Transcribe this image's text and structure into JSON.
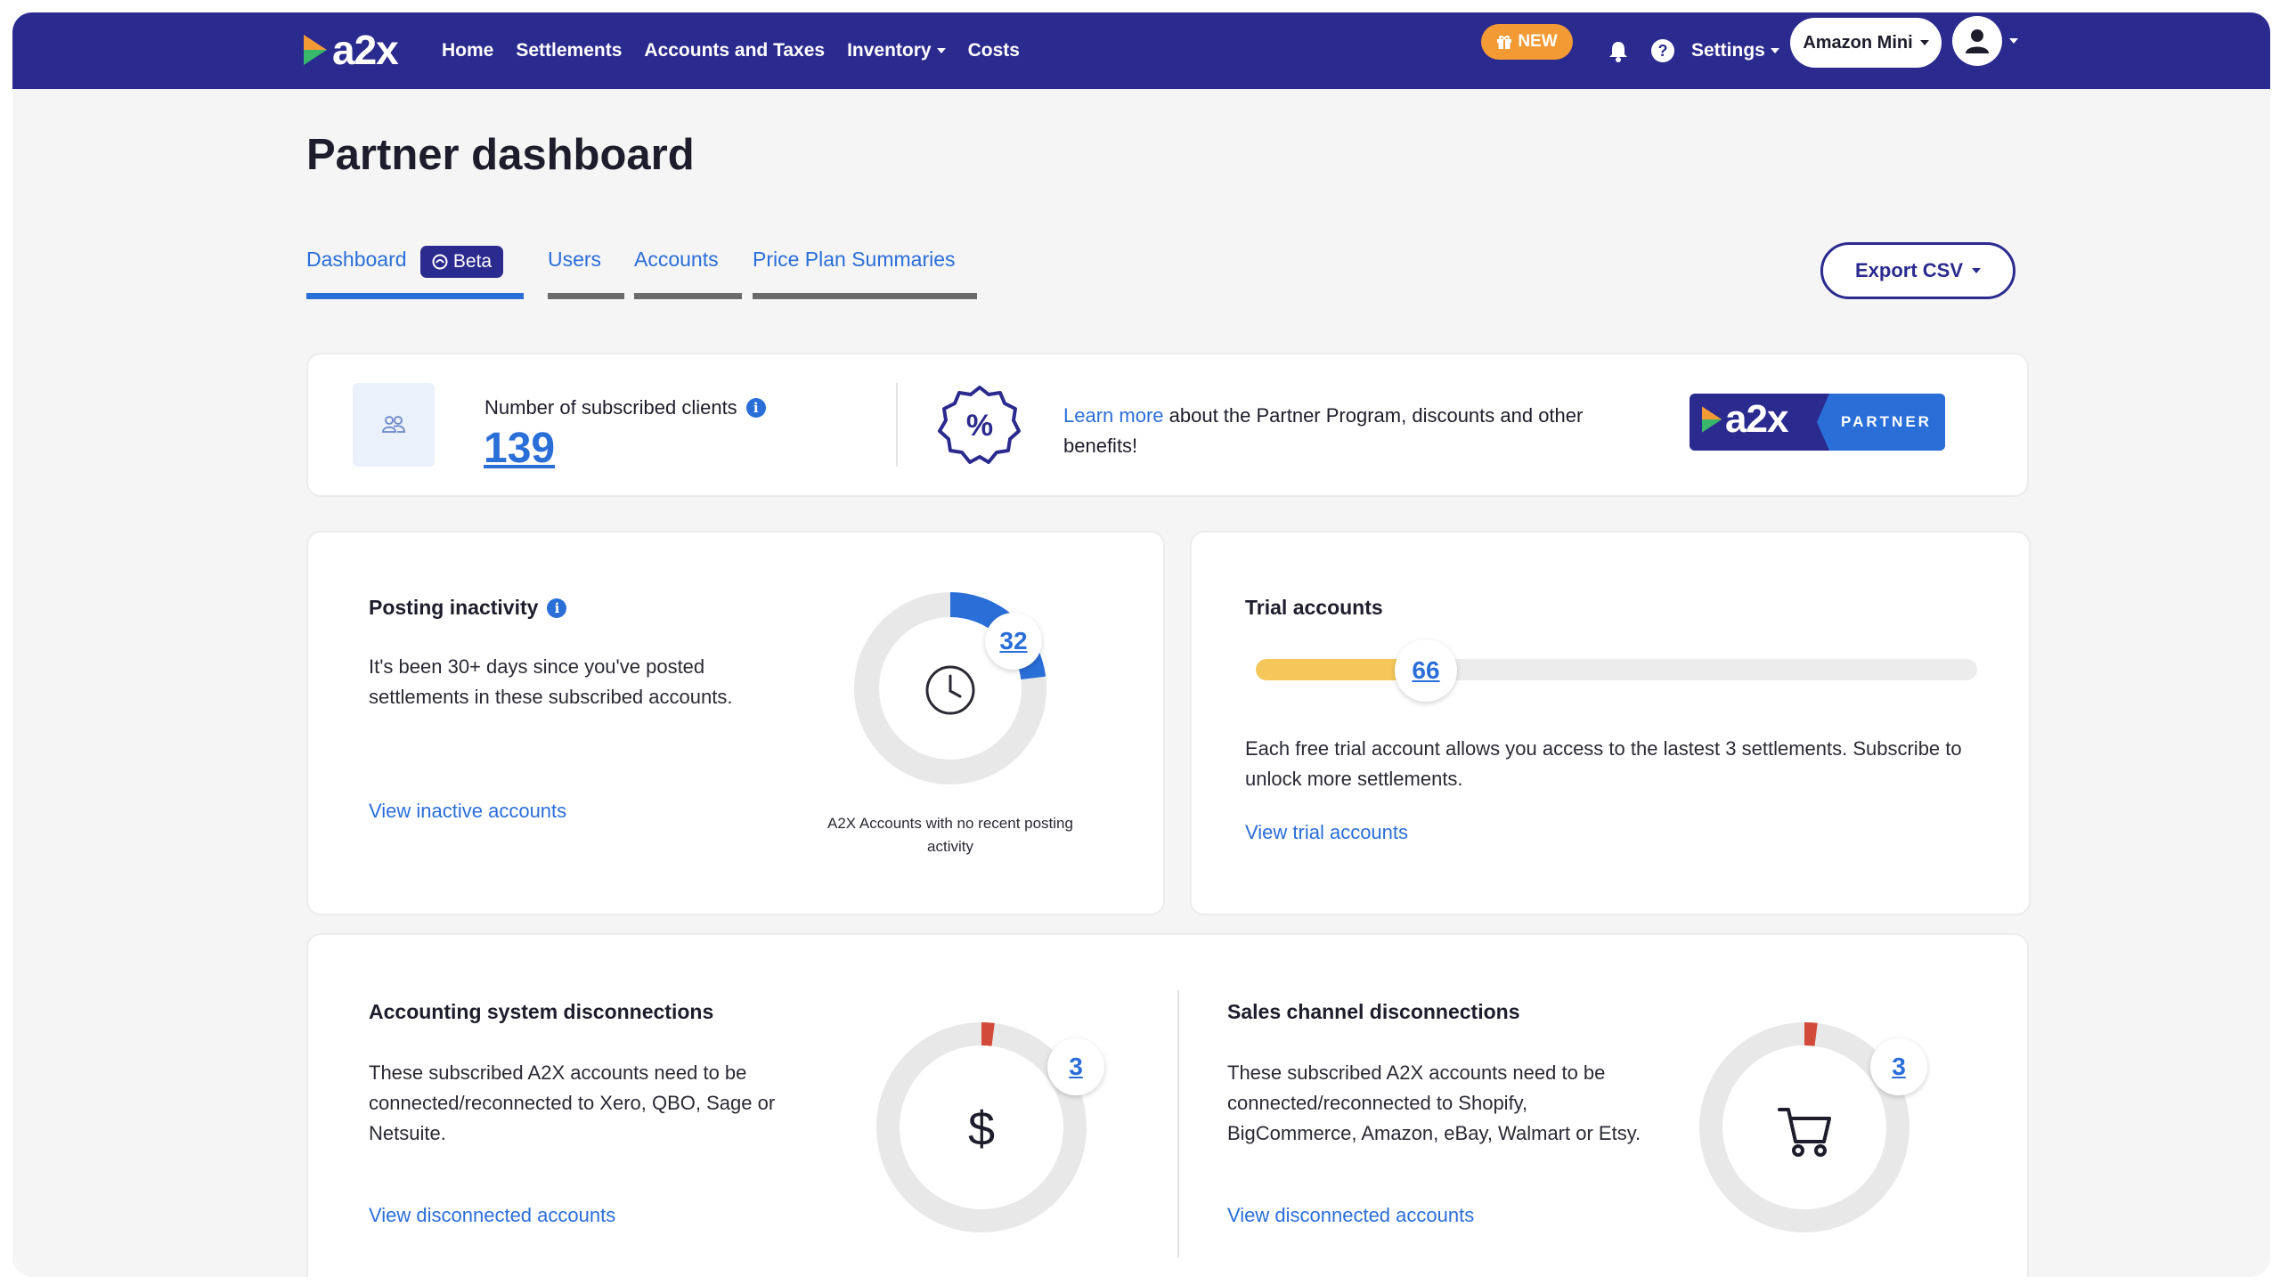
{
  "app": {
    "logo_text": "a2x",
    "colors": {
      "nav": "#2b2a8e",
      "accent": "#2a6ed8",
      "new_pill": "#f39a35",
      "logo_arrow_orange": "#f39a35",
      "logo_arrow_green": "#38b86a",
      "trial_fill": "#f5c75a",
      "alert": "#d24b3a"
    }
  },
  "nav": {
    "links": [
      {
        "label": "Home"
      },
      {
        "label": "Settlements"
      },
      {
        "label": "Accounts and Taxes"
      },
      {
        "label": "Inventory",
        "has_dropdown": true
      },
      {
        "label": "Costs"
      }
    ],
    "new_label": "NEW",
    "new_icon": "gift-icon",
    "bell_icon": "bell-icon",
    "help_icon": "help-icon",
    "settings_label": "Settings",
    "account_select": "Amazon Mini",
    "avatar_icon": "user-icon"
  },
  "page": {
    "title": "Partner dashboard",
    "tabs": [
      {
        "label": "Dashboard",
        "active": true,
        "badge": "Beta"
      },
      {
        "label": "Users",
        "active": false
      },
      {
        "label": "Accounts",
        "active": false
      },
      {
        "label": "Price Plan Summaries",
        "active": false
      }
    ],
    "export_label": "Export CSV"
  },
  "summary": {
    "clients_label": "Number of subscribed clients",
    "clients_count": "139",
    "learn_link": "Learn more",
    "learn_text": " about the Partner Program, discounts and other benefits!",
    "partner_logo_left": "a2x",
    "partner_logo_right": "PARTNER"
  },
  "posting_inactivity": {
    "title": "Posting inactivity",
    "text": "It's been 30+ days since you've posted settlements in these subscribed accounts.",
    "link": "View inactive accounts",
    "count": "32",
    "fraction": 0.23,
    "caption": "A2X Accounts with no recent posting activity",
    "icon": "clock-icon"
  },
  "trial": {
    "title": "Trial accounts",
    "count": "66",
    "fraction": 0.2,
    "text": "Each free trial account allows you access to the lastest 3 settlements. Subscribe to unlock more settlements.",
    "link": "View trial accounts"
  },
  "accounting_disc": {
    "title": "Accounting system disconnections",
    "text": "These subscribed A2X accounts need to be connected/reconnected to Xero, QBO, Sage or Netsuite.",
    "link": "View disconnected accounts",
    "count": "3",
    "fraction": 0.02,
    "icon": "dollar-icon",
    "icon_glyph": "$"
  },
  "sales_disc": {
    "title": "Sales channel disconnections",
    "text": "These subscribed A2X accounts need to be connected/reconnected to Shopify, BigCommerce, Amazon, eBay, Walmart or Etsy.",
    "link": "View disconnected accounts",
    "count": "3",
    "fraction": 0.02,
    "icon": "cart-icon"
  }
}
